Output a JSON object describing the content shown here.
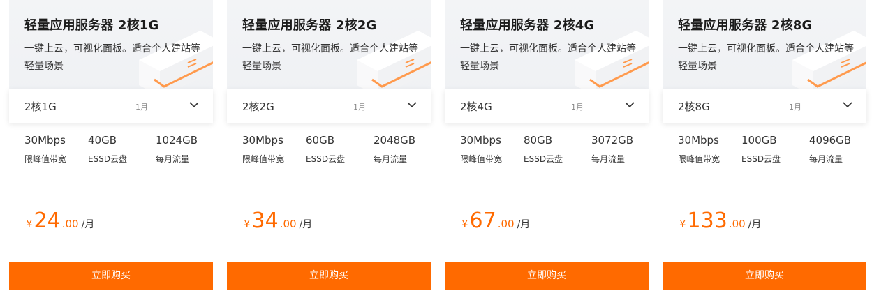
{
  "accent_color": "#ff6a00",
  "cards": [
    {
      "title": "轻量应用服务器 2核1G",
      "description": "一键上云，可视化面板。适合个人建站等轻量场景",
      "select_value": "2核1G",
      "select_period": "1月",
      "specs": [
        {
          "value": "30Mbps",
          "label": "限峰值带宽"
        },
        {
          "value": "40GB",
          "label": "ESSD云盘"
        },
        {
          "value": "1024GB",
          "label": "每月流量"
        }
      ],
      "price": {
        "currency": "¥",
        "integer": "24",
        "decimal": ".00",
        "unit": "/月"
      },
      "buy_label": "立即购买"
    },
    {
      "title": "轻量应用服务器 2核2G",
      "description": "一键上云，可视化面板。适合个人建站等轻量场景",
      "select_value": "2核2G",
      "select_period": "1月",
      "specs": [
        {
          "value": "30Mbps",
          "label": "限峰值带宽"
        },
        {
          "value": "60GB",
          "label": "ESSD云盘"
        },
        {
          "value": "2048GB",
          "label": "每月流量"
        }
      ],
      "price": {
        "currency": "¥",
        "integer": "34",
        "decimal": ".00",
        "unit": "/月"
      },
      "buy_label": "立即购买"
    },
    {
      "title": "轻量应用服务器 2核4G",
      "description": "一键上云，可视化面板。适合个人建站等轻量场景",
      "select_value": "2核4G",
      "select_period": "1月",
      "specs": [
        {
          "value": "30Mbps",
          "label": "限峰值带宽"
        },
        {
          "value": "80GB",
          "label": "ESSD云盘"
        },
        {
          "value": "3072GB",
          "label": "每月流量"
        }
      ],
      "price": {
        "currency": "¥",
        "integer": "67",
        "decimal": ".00",
        "unit": "/月"
      },
      "buy_label": "立即购买"
    },
    {
      "title": "轻量应用服务器 2核8G",
      "description": "一键上云，可视化面板。适合个人建站等轻量场景",
      "select_value": "2核8G",
      "select_period": "1月",
      "specs": [
        {
          "value": "30Mbps",
          "label": "限峰值带宽"
        },
        {
          "value": "100GB",
          "label": "ESSD云盘"
        },
        {
          "value": "4096GB",
          "label": "每月流量"
        }
      ],
      "price": {
        "currency": "¥",
        "integer": "133",
        "decimal": ".00",
        "unit": "/月"
      },
      "buy_label": "立即购买"
    }
  ]
}
